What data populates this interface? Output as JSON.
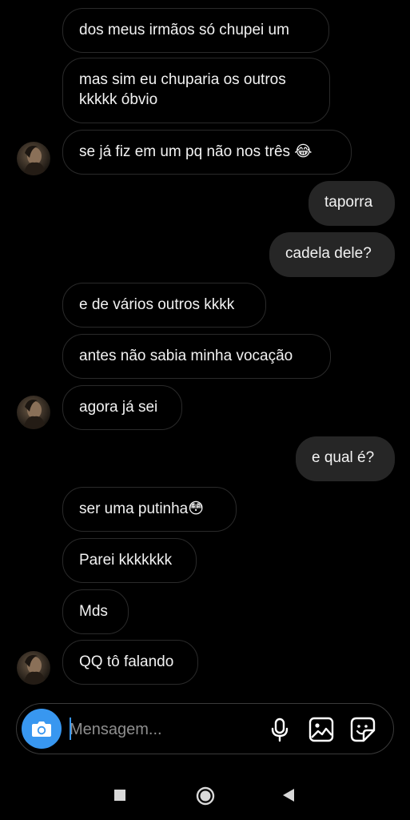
{
  "thread": {
    "messages": [
      {
        "dir": "in",
        "text": "dos meus irmãos só chupei um"
      },
      {
        "dir": "in",
        "text": "mas sim eu chuparia os outros\nkkkkk óbvio"
      },
      {
        "dir": "in",
        "text": "se já fiz em um pq não nos três 😂"
      },
      {
        "dir": "out",
        "text": "taporra"
      },
      {
        "dir": "out",
        "text": "cadela dele?"
      },
      {
        "dir": "in",
        "text": "e de vários outros kkkk"
      },
      {
        "dir": "in",
        "text": "antes não sabia minha vocação"
      },
      {
        "dir": "in",
        "text": "agora já sei"
      },
      {
        "dir": "out",
        "text": "e qual é?"
      },
      {
        "dir": "in",
        "text": "ser uma putinha😳"
      },
      {
        "dir": "in",
        "text": "Parei kkkkkkk"
      },
      {
        "dir": "in",
        "text": "Mds"
      },
      {
        "dir": "in",
        "text": "QQ tô falando"
      }
    ]
  },
  "composer": {
    "placeholder": "Mensagem...",
    "camera_icon": "camera-icon",
    "mic_icon": "microphone-icon",
    "gallery_icon": "gallery-icon",
    "sticker_icon": "sticker-icon"
  },
  "navbar": {
    "recents_icon": "square-icon",
    "home_icon": "circle-icon",
    "back_icon": "triangle-back-icon"
  },
  "colors": {
    "background": "#000000",
    "outgoing_bubble": "#262626",
    "incoming_border": "#2a2a2a",
    "accent": "#3897f0"
  }
}
